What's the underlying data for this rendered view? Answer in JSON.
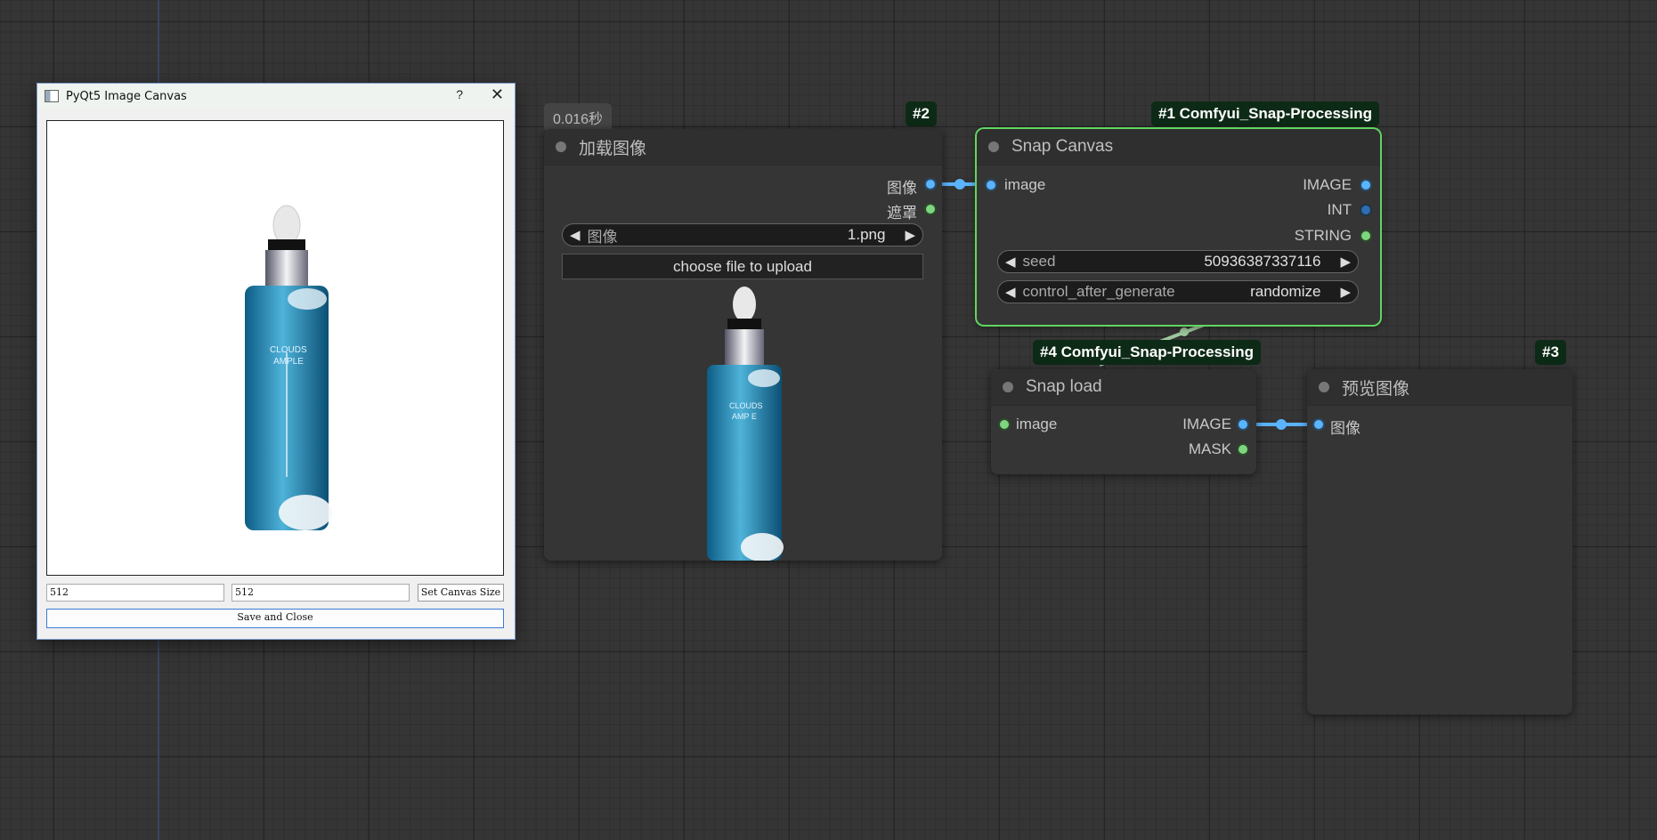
{
  "dialog": {
    "title": "PyQt5 Image Canvas",
    "help_label": "?",
    "close_label": "✕",
    "width_value": "512",
    "height_value": "512",
    "set_size_label": "Set Canvas Size",
    "save_label": "Save and Close",
    "bottle_text_line1": "CLOUDS",
    "bottle_text_line2": "AMPLE"
  },
  "exec_time": "0.016秒",
  "load_node": {
    "badge": "#2",
    "title": "加载图像",
    "out_image": "图像",
    "out_mask": "遮罩",
    "image_widget_label": "图像",
    "image_widget_value": "1.png",
    "upload_label": "choose file to upload",
    "bottle_text_line1": "CLOUDS",
    "bottle_text_line2": "AMP E"
  },
  "snap_canvas": {
    "badge": "#1 Comfyui_Snap-Processing",
    "title": "Snap Canvas",
    "in_image": "image",
    "out_image": "IMAGE",
    "out_int": "INT",
    "out_string": "STRING",
    "seed_label": "seed",
    "seed_value": "50936387337116",
    "control_label": "control_after_generate",
    "control_value": "randomize"
  },
  "snap_load": {
    "badge": "#4 Comfyui_Snap-Processing",
    "title": "Snap load",
    "in_image": "image",
    "out_image": "IMAGE",
    "out_mask": "MASK"
  },
  "preview_node": {
    "badge": "#3",
    "title": "预览图像",
    "in_image": "图像"
  },
  "colors": {
    "selected_outline": "#5fd65f",
    "image_port": "#5ab4ff",
    "mask_port": "#7ed67e"
  }
}
